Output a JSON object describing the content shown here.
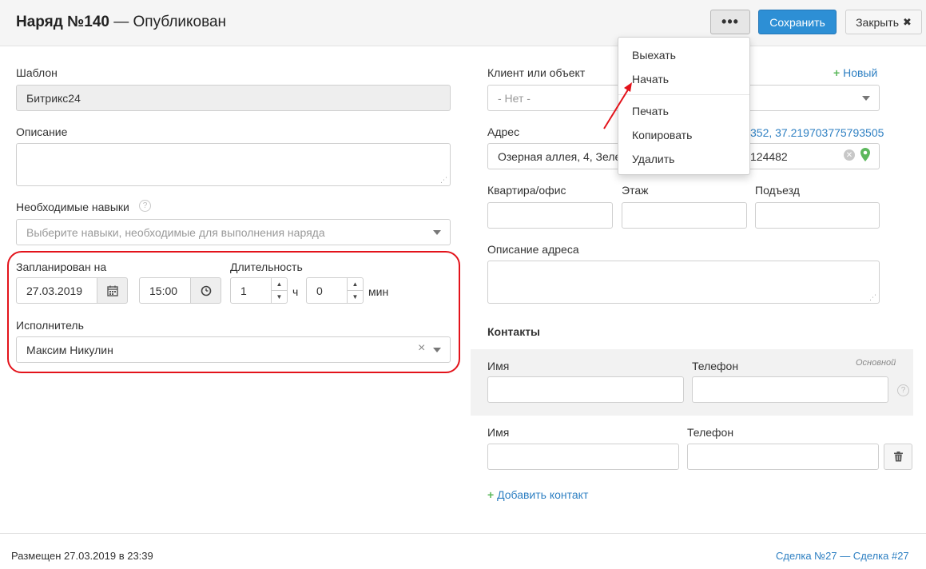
{
  "header": {
    "title_bold": "Наряд №140",
    "title_rest": " — Опубликован",
    "more_label": "•••",
    "save_label": "Сохранить",
    "close_label": "Закрыть",
    "close_icon": "✖"
  },
  "form": {
    "template_label": "Шаблон",
    "template_value": "Битрикс24",
    "description_label": "Описание",
    "description_value": "",
    "skills_label": "Необходимые навыки",
    "skills_help": "?",
    "skills_placeholder": "Выберите навыки, необходимые для выполнения наряда",
    "planned_label": "Запланирован на",
    "planned_date": "27.03.2019",
    "planned_time": "15:00",
    "duration_label": "Длительность",
    "duration_hours": "1",
    "hours_unit": "ч",
    "duration_minutes": "0",
    "minutes_unit": "мин",
    "executor_label": "Исполнитель",
    "executor_value": "Максим Никулин",
    "executor_clear": "×"
  },
  "right": {
    "client_label": "Клиент или объект",
    "client_new": "Новый",
    "client_value": "- Нет -",
    "address_label": "Адрес",
    "address_coords": "352, 37.219703775793505",
    "address_value": "Озерная аллея, 4, Зеле",
    "address_value_tail": "124482",
    "apartment_label": "Квартира/офис",
    "floor_label": "Этаж",
    "entrance_label": "Подъезд",
    "address_desc_label": "Описание адреса",
    "contacts_title": "Контакты",
    "main_tag": "Основной",
    "contact_name_label": "Имя",
    "contact_phone_label": "Телефон",
    "contact2_name_label": "Имя",
    "contact2_phone_label": "Телефон",
    "add_contact_label": "Добавить контакт"
  },
  "dropdown": {
    "items": [
      "Выехать",
      "Начать",
      "Печать",
      "Копировать",
      "Удалить"
    ]
  },
  "footer": {
    "posted": "Размещен 27.03.2019 в 23:39",
    "deal_link": "Сделка №27 — Сделка #27"
  }
}
